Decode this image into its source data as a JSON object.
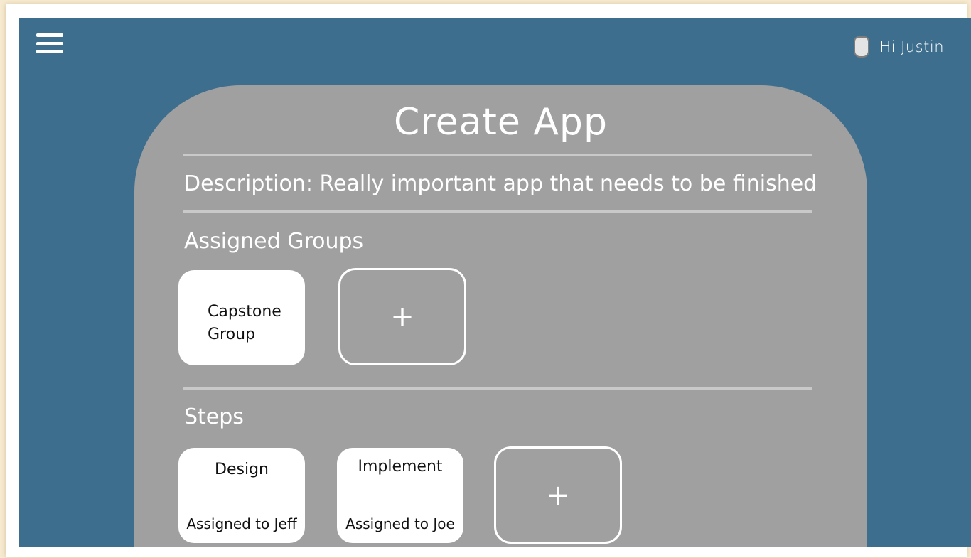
{
  "header": {
    "menu_icon": "hamburger-menu-icon",
    "user_icon": "user-avatar-icon",
    "greeting": "Hi Justin"
  },
  "card": {
    "title": "Create App",
    "description": "Description: Really important app that needs to be finished",
    "groups_label": "Assigned Groups",
    "groups": [
      {
        "name": "Capstone Group"
      }
    ],
    "add_group_label": "+",
    "steps_label": "Steps",
    "steps": [
      {
        "name": "Design",
        "assignee": "Assigned to Jeff"
      },
      {
        "name": "Implement",
        "assignee": "Assigned to Joe"
      }
    ],
    "add_step_label": "+"
  },
  "colors": {
    "app_background": "#3e6e8e",
    "card_background": "#a0a0a0",
    "tile_background": "#ffffff",
    "text_light": "#ffffff",
    "text_dark": "#111111"
  }
}
